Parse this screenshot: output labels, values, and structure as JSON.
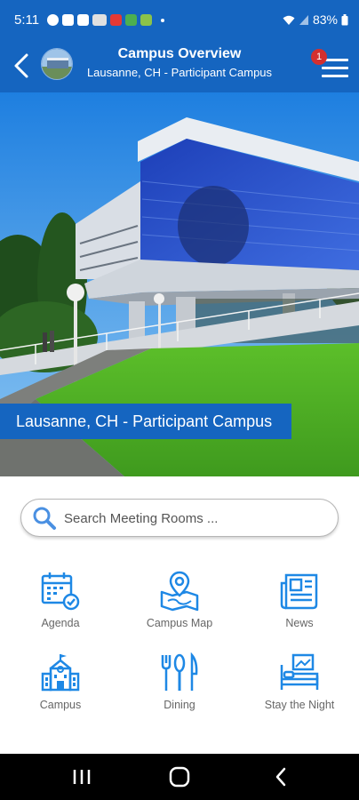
{
  "status_bar": {
    "time": "5:11",
    "battery": "83%"
  },
  "header": {
    "title": "Campus Overview",
    "subtitle": "Lausanne, CH - Participant Campus",
    "notification_count": "1"
  },
  "hero": {
    "caption": "Lausanne, CH - Participant Campus"
  },
  "search": {
    "placeholder": "Search Meeting Rooms ..."
  },
  "tiles": [
    {
      "label": "Agenda",
      "icon": "calendar-check-icon"
    },
    {
      "label": "Campus Map",
      "icon": "map-pin-icon"
    },
    {
      "label": "News",
      "icon": "newspaper-icon"
    },
    {
      "label": "Campus",
      "icon": "school-building-icon"
    },
    {
      "label": "Dining",
      "icon": "fork-spoon-knife-icon"
    },
    {
      "label": "Stay the Night",
      "icon": "bed-icon"
    }
  ],
  "colors": {
    "primary": "#1565c0",
    "icon_blue": "#1e88e5",
    "badge_red": "#d32f2f"
  }
}
